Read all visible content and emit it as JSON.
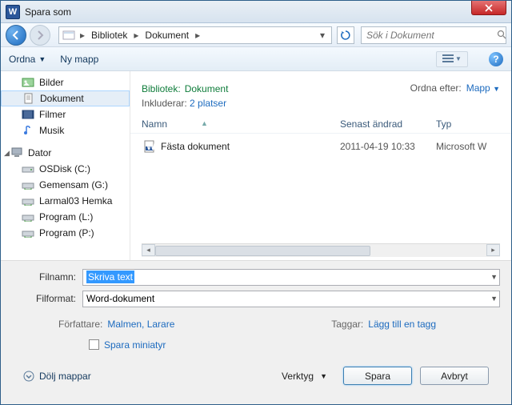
{
  "title": "Spara som",
  "breadcrumb": {
    "root": "Bibliotek",
    "current": "Dokument"
  },
  "search": {
    "placeholder": "Sök i Dokument"
  },
  "toolbar": {
    "organize": "Ordna",
    "newfolder": "Ny mapp"
  },
  "sidebar": {
    "items": [
      {
        "label": "Bilder"
      },
      {
        "label": "Dokument"
      },
      {
        "label": "Filmer"
      },
      {
        "label": "Musik"
      }
    ],
    "computer": "Dator",
    "drives": [
      {
        "label": "OSDisk (C:)"
      },
      {
        "label": "Gemensam (G:)"
      },
      {
        "label": "Larmal03 Hemka"
      },
      {
        "label": "Program (L:)"
      },
      {
        "label": "Program (P:)"
      }
    ]
  },
  "location": {
    "library_prefix": "Bibliotek:",
    "name": "Dokument",
    "includes_label": "Inkluderar:",
    "includes_link": "2 platser",
    "sort_label": "Ordna efter:",
    "sort_value": "Mapp"
  },
  "columns": {
    "name": "Namn",
    "date": "Senast ändrad",
    "type": "Typ"
  },
  "files": [
    {
      "name": "Fästa dokument",
      "date": "2011-04-19 10:33",
      "type": "Microsoft W"
    }
  ],
  "form": {
    "filename_label": "Filnamn:",
    "filename_value": "Skriva text",
    "format_label": "Filformat:",
    "format_value": "Word-dokument",
    "author_label": "Författare:",
    "author_value": "Malmen, Larare",
    "tags_label": "Taggar:",
    "tags_value": "Lägg till en tagg",
    "thumbnail": "Spara miniatyr"
  },
  "actions": {
    "hide_folders": "Dölj mappar",
    "tools": "Verktyg",
    "save": "Spara",
    "cancel": "Avbryt"
  }
}
